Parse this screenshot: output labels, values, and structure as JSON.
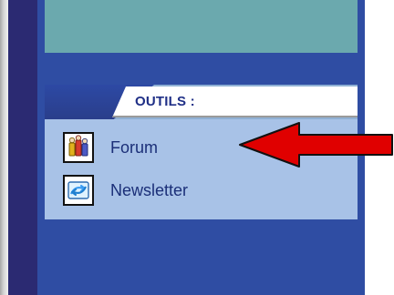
{
  "panel": {
    "section_title": "OUTILS :"
  },
  "tools": {
    "items": [
      {
        "label": "Forum",
        "icon": "forum-icon"
      },
      {
        "label": "Newsletter",
        "icon": "newsletter-icon"
      }
    ]
  },
  "annotation": {
    "arrow_color": "#e00000"
  }
}
